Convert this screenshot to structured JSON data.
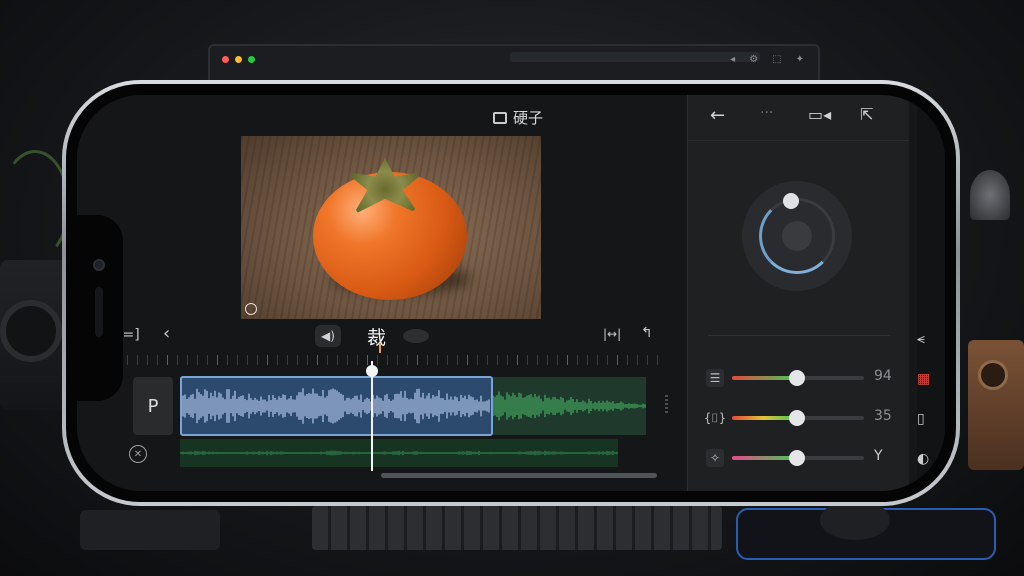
{
  "project": {
    "title": "硬子"
  },
  "editor": {
    "cut_label": "裁",
    "track_label": "P"
  },
  "colors": {
    "clip_selected_fill": "#2b4a6e",
    "clip_selected_border": "#7aa4d6",
    "waveform_blue": "#9fb6d8",
    "waveform_green": "#3f9b5a",
    "playhead": "#f3f3f3",
    "marker": "#e6a04a",
    "slider_accent_red": "#e44a3a",
    "slider_accent_green": "#4cc45a"
  },
  "right_panel": {
    "sliders": [
      {
        "name": "slider-1",
        "icon": "adjust-icon",
        "value_label": "94",
        "level": 0.48
      },
      {
        "name": "slider-2",
        "icon": "crop-icon",
        "value_label": "35",
        "level": 0.48
      },
      {
        "name": "slider-3",
        "icon": "sparkle-icon",
        "value_label": "Y",
        "level": 0.48
      }
    ]
  },
  "icons": {
    "back": "arrow-left-icon",
    "more": "more-dots-icon",
    "camera": "video-camera-icon",
    "share": "share-icon",
    "volume": "speaker-icon",
    "collapse": "collapse-icon"
  }
}
